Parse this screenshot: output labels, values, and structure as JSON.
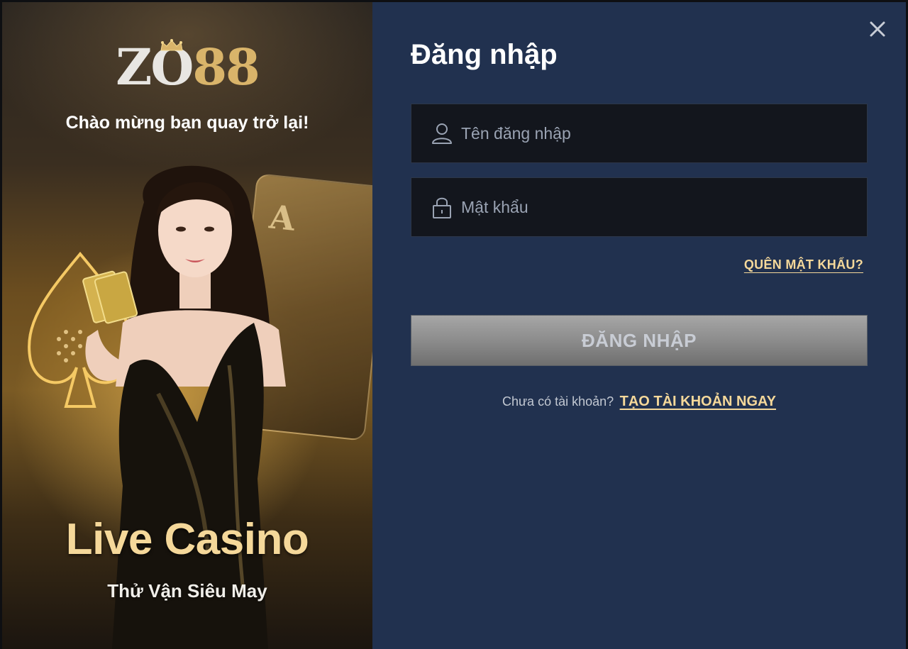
{
  "promo": {
    "logo_left": "ZO",
    "logo_right": "88",
    "greeting": "Chào mừng bạn quay trở lại!",
    "title": "Live Casino",
    "subtitle": "Thử Vận Siêu May",
    "card_letter": "A"
  },
  "login": {
    "title": "Đăng nhập",
    "username_placeholder": "Tên đăng nhập",
    "password_placeholder": "Mật khẩu",
    "forgot_label": "QUÊN MẬT KHẨU?",
    "submit_label": "ĐĂNG NHẬP",
    "signup_prompt": "Chưa có tài khoản?",
    "signup_label": "TẠO TÀI KHOẢN NGAY"
  },
  "icons": {
    "close": "close-icon",
    "user": "user-icon",
    "lock": "lock-icon",
    "crown": "crown-icon"
  },
  "colors": {
    "panel_bg": "#21314f",
    "input_bg": "#13161d",
    "accent_gold": "#f5d89a",
    "button_gray": "#8c8c8c"
  }
}
